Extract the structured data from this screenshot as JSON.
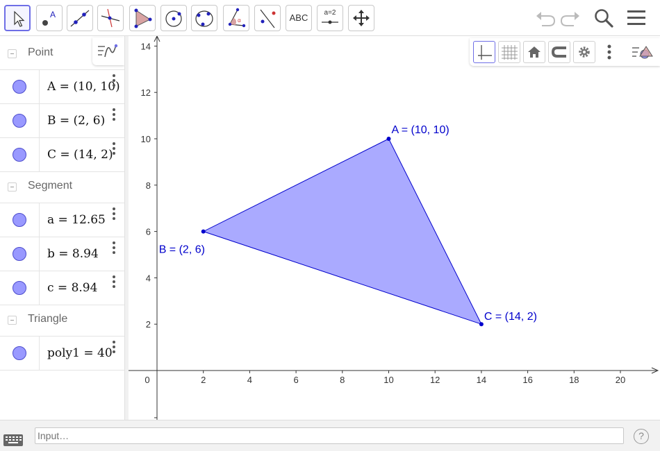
{
  "toolbar": {
    "tools": [
      "move-tool",
      "point-tool",
      "line-tool",
      "perpendicular-line-tool",
      "polygon-tool",
      "circle-with-center-tool",
      "circle-through-3-points-tool",
      "angle-tool",
      "reflect-about-line-tool",
      "text-tool",
      "slider-tool",
      "move-graphics-view-tool"
    ],
    "text_tool_label": "ABC",
    "slider_tool_label": "a=2",
    "right_icons": [
      "undo-icon",
      "redo-icon",
      "search-icon",
      "menu-icon"
    ]
  },
  "algebra": {
    "groups": [
      {
        "title": "Point",
        "items": [
          "A = (10, 10)",
          "B = (2, 6)",
          "C = (14, 2)"
        ]
      },
      {
        "title": "Segment",
        "items": [
          "a = 12.65",
          "b = 8.94",
          "c = 8.94"
        ]
      },
      {
        "title": "Triangle",
        "items": [
          "poly1 = 40"
        ]
      }
    ]
  },
  "graphics": {
    "x_ticks": [
      "0",
      "2",
      "4",
      "6",
      "8",
      "10",
      "12",
      "14",
      "16",
      "18",
      "20"
    ],
    "y_ticks": [
      "2",
      "4",
      "6",
      "8",
      "10",
      "12",
      "14"
    ],
    "points": [
      {
        "name": "A",
        "x": 10,
        "y": 10,
        "label": "A = (10, 10)"
      },
      {
        "name": "B",
        "x": 2,
        "y": 6,
        "label": "B = (2, 6)"
      },
      {
        "name": "C",
        "x": 14,
        "y": 2,
        "label": "C = (14, 2)"
      }
    ],
    "polygon_fill": "#aaaaff",
    "object_color": "#0000cc",
    "style_bar_icons": [
      "axes-icon",
      "grid-icon",
      "home-icon",
      "magnet-icon",
      "gear-icon",
      "more-icon",
      "view-menu-icon"
    ]
  },
  "input_bar": {
    "placeholder": "Input…",
    "help_label": "?"
  }
}
